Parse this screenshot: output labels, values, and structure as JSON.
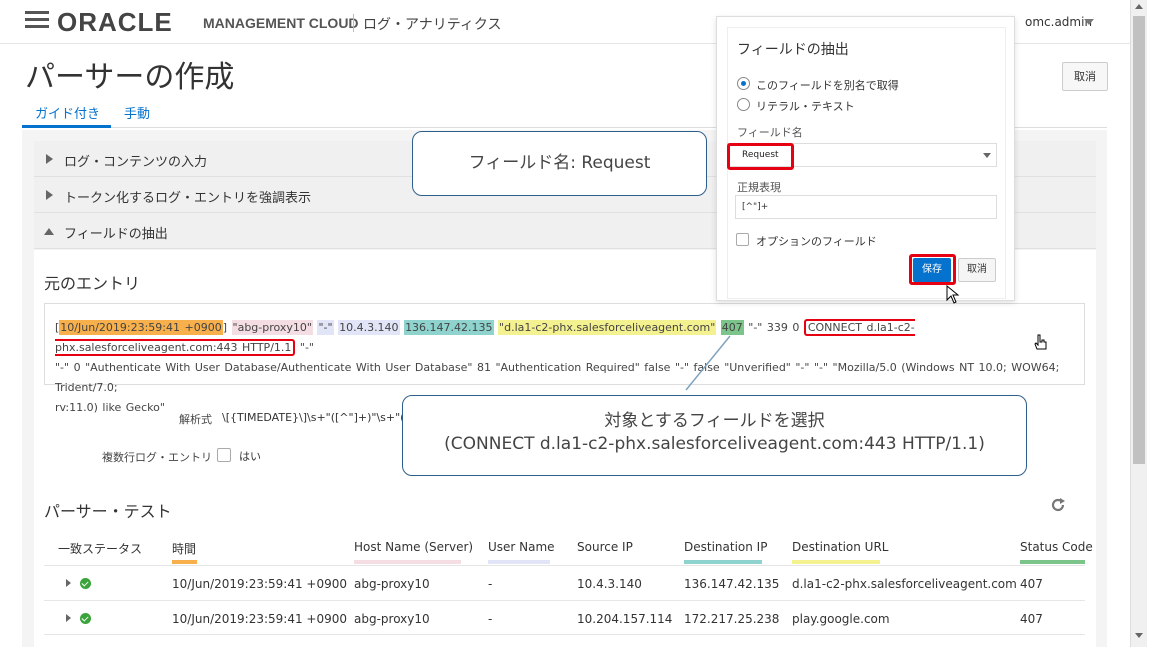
{
  "header": {
    "brand": "ORACLE",
    "product": "MANAGEMENT CLOUD",
    "app": "ログ・アナリティクス",
    "user": "omc.admin"
  },
  "page": {
    "title": "パーサーの作成",
    "cancel": "取消"
  },
  "tabs": [
    {
      "label": "ガイド付き"
    },
    {
      "label": "手動"
    }
  ],
  "accordion": [
    {
      "label": "ログ・コンテンツの入力"
    },
    {
      "label": "トークン化するログ・エントリを強調表示"
    },
    {
      "label": "フィールドの抽出"
    }
  ],
  "original_entry": {
    "title": "元のエントリ",
    "line1": {
      "open": "[",
      "time": "10/Jun/2019:23:59:41  +0900",
      "close": "]",
      "q1": "\"abg-proxy10\"",
      "q2": "\"-\"",
      "src_ip": "10.4.3.140",
      "dst_ip": "136.147.42.135",
      "url": "\"d.la1-c2-phx.salesforceliveagent.com\"",
      "status": "407",
      "mid": "\"-\" 339 0",
      "request": "CONNECT  d.la1-c2-phx.salesforceliveagent.com:443  HTTP/1.1",
      "tail": "\"-\""
    },
    "line2": "\"-\" 0 \"Authenticate With User Database/Authenticate With User Database\" 81 \"Authentication Required\" false \"-\" false \"Unverified\" \"-\" \"-\" \"Mozilla/5.0 (Windows NT 10.0; WOW64; Trident/7.0;",
    "line3": "rv:11.0) like Gecko\""
  },
  "parse": {
    "label": "解析式",
    "expression": "\\[{TIMEDATE}\\]\\s+\"([^\"]+)\"\\s+\"([^\"]+)\""
  },
  "multiline": {
    "label": "複数行ログ・エントリ",
    "option": "はい"
  },
  "parser_test": {
    "title": "パーサー・テスト",
    "columns": [
      {
        "label": "一致ステータス",
        "color": ""
      },
      {
        "label": "時間",
        "color": "#f7b04b"
      },
      {
        "label": "Host Name (Server)",
        "color": "#f5dde4"
      },
      {
        "label": "User Name",
        "color": "#e2e4f7"
      },
      {
        "label": "Source IP",
        "color": ""
      },
      {
        "label": "Destination IP",
        "color": "#8ed3cd"
      },
      {
        "label": "Destination URL",
        "color": "#f4f190"
      },
      {
        "label": "Status Code",
        "color": "#7cc58a"
      }
    ],
    "rows": [
      {
        "time": "10/Jun/2019:23:59:41 +0900",
        "host": "abg-proxy10",
        "user": "-",
        "src": "10.4.3.140",
        "dst": "136.147.42.135",
        "url": "d.la1-c2-phx.salesforceliveagent.com",
        "code": "407"
      },
      {
        "time": "10/Jun/2019:23:59:41 +0900",
        "host": "abg-proxy10",
        "user": "-",
        "src": "10.204.157.114",
        "dst": "172.217.25.238",
        "url": "play.google.com",
        "code": "407"
      }
    ]
  },
  "popup": {
    "title": "フィールドの抽出",
    "radio1": "このフィールドを別名で取得",
    "radio2": "リテラル・テキスト",
    "field_name_label": "フィールド名",
    "field_name_value": "Request",
    "regex_label": "正規表現",
    "regex_value": "[^\"]+",
    "optional_label": "オプションのフィールド",
    "save": "保存",
    "cancel": "取消"
  },
  "callouts": {
    "field_name": "フィールド名: Request",
    "select_line1": "対象とするフィールドを選択",
    "select_line2": "(CONNECT d.la1-c2-phx.salesforceliveagent.com:443  HTTP/1.1)"
  },
  "colors": {
    "accent": "#0572ce",
    "highlight_red": "#e60012",
    "callout_border": "#2e5f8a"
  }
}
